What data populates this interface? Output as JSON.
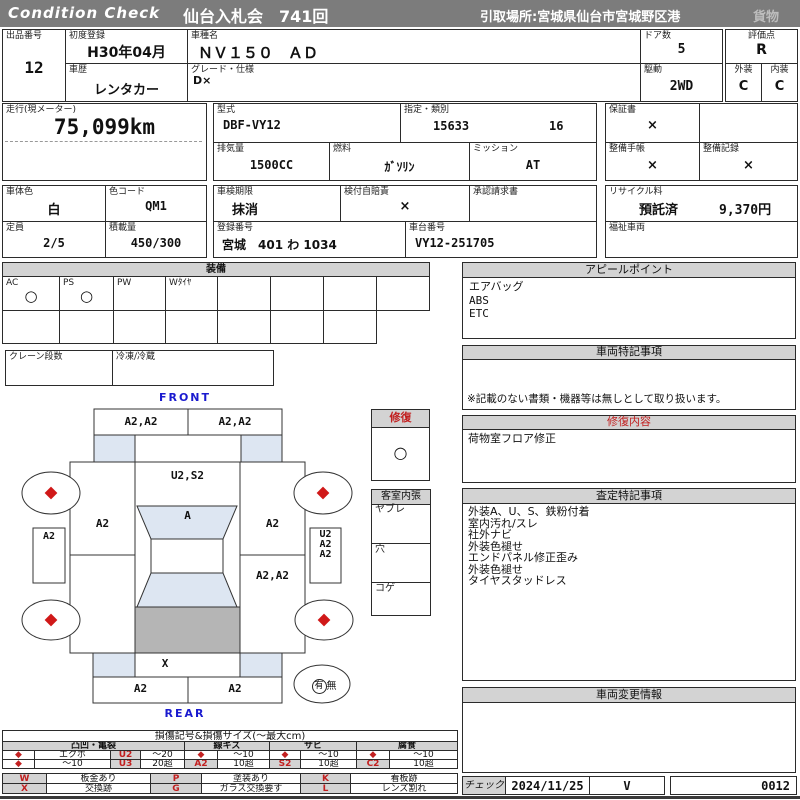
{
  "header": {
    "brand": "Condition  Check",
    "title": "仙台入札会　741回",
    "pickup": "引取場所:宮城県仙台市宮城野区港",
    "category": "貨物"
  },
  "row1": {
    "lot_label": "出品番号",
    "lot": "12",
    "first_reg_label": "初度登録",
    "first_reg": "H30年04月",
    "history_label": "車歴",
    "history": "レンタカー",
    "model_label": "車種名",
    "model": "ＮＶ１５０　ＡＤ",
    "grade_label": "グレード・仕様",
    "grade": "D×",
    "doors_label": "ドア数",
    "doors": "5",
    "drive_label": "駆動",
    "drive": "2WD",
    "score_label": "評価点",
    "score": "R",
    "exterior_label": "外装",
    "exterior": "C",
    "interior_label": "内装",
    "interior": "C"
  },
  "row2": {
    "mileage_label": "走行(現メーター)",
    "mileage": "75,099km",
    "model_code_label": "型式",
    "model_code": "DBF-VY12",
    "class_label": "指定・類別",
    "class1": "15633",
    "class2": "16",
    "displacement_label": "排気量",
    "displacement": "1500CC",
    "fuel_label": "燃料",
    "fuel": "ｶﾞｿﾘﾝ",
    "mission_label": "ミッション",
    "mission": "AT",
    "warranty_label": "保証書",
    "warranty": "×",
    "book_label": "整備手帳",
    "book": "×",
    "record_label": "整備記録",
    "record": "×"
  },
  "row3": {
    "body_color_label": "車体色",
    "body_color": "白",
    "color_code_label": "色コード",
    "color_code": "QM1",
    "capacity_label": "定員",
    "capacity": "2/5",
    "load_label": "積載量",
    "load": "450/300",
    "shaken_label": "車検期限",
    "shaken": "抹消",
    "jibaiseki_label": "検付自賠責",
    "jibaiseki": "×",
    "approval_label": "承認請求書",
    "reg_label": "登録番号",
    "reg_no": "宮城　401 わ 1034",
    "chassis_label": "車台番号",
    "chassis": "VY12-251705",
    "recycle_label": "リサイクル料",
    "recycle_status": "預託済",
    "recycle_fee": "9,370円",
    "welfare_label": "福祉車両"
  },
  "equipment": {
    "title": "装備",
    "c1_label": "AC",
    "c1_mark": "○",
    "c2_label": "PS",
    "c2_mark": "○",
    "c3_label": "PW",
    "c4_label": "Wﾀｲﾔ",
    "crane_label": "クレーン段数",
    "reefer_label": "冷凍/冷蔵"
  },
  "diagram": {
    "front": "FRONT",
    "rear": "REAR",
    "front_bumper_l": "A2,A2",
    "front_bumper_r": "A2,A2",
    "hood": "U2,S2",
    "windshield": "A",
    "fender_l": "A2",
    "fender_r": "A2",
    "mirror_l": "A2",
    "side_r1": "U2",
    "side_r2": "A2",
    "side_r3": "A2",
    "door_r": "A2,A2",
    "rear_panel": "X",
    "rear_bumper_l": "A2",
    "rear_bumper_r": "A2",
    "spare_yes": "有",
    "spare_no": "無"
  },
  "repair_box": {
    "title": "修復",
    "mark": "○"
  },
  "trim_box": {
    "title": "客室内張",
    "item1": "ヤブレ",
    "item2": "穴",
    "item3": "コゲ"
  },
  "panels": {
    "appeal_title": "アピールポイント",
    "appeal1": "エアバッグ",
    "appeal2": "ABS",
    "appeal3": "ETC",
    "special_title": "車両特記事項",
    "special_note": "※記載のない書類・機器等は無しとして取り扱います。",
    "repair_title": "修復内容",
    "repair_note": "荷物室フロア修正",
    "assess_title": "査定特記事項",
    "assess1": "外装A、U、S、鉄粉付着",
    "assess2": "室内汚れ/スレ",
    "assess3": "社外ナビ",
    "assess4": "外装色褪せ",
    "assess5": "エンドパネル修正歪み",
    "assess6": "外装色褪せ",
    "assess7": "タイヤスタッドレス",
    "change_title": "車両変更情報"
  },
  "legend": {
    "title": "損傷記号&損傷サイズ(～最大cm)",
    "g1": "凸凹・亀裂",
    "g2": "線キズ",
    "g3": "サビ",
    "g4": "腐食",
    "r1": [
      "◆",
      "エクボ",
      "U2",
      "～20",
      "◆",
      "～10",
      "◆",
      "～10",
      "◆",
      "～10"
    ],
    "r2": [
      "◆",
      "～10",
      "U3",
      "20超",
      "A2",
      "10超",
      "S2",
      "10超",
      "C2",
      "10超"
    ],
    "codes": [
      {
        "code": "W",
        "desc": "板金あり"
      },
      {
        "code": "P",
        "desc": "塗装あり"
      },
      {
        "code": "K",
        "desc": "看板跡"
      },
      {
        "code": "X",
        "desc": "交換跡"
      },
      {
        "code": "G",
        "desc": "ガラス交換要す"
      },
      {
        "code": "L",
        "desc": "レンズ割れ"
      }
    ]
  },
  "check": {
    "label": "チェック",
    "date": "2024/11/25",
    "inspector": "V",
    "serial": "0012"
  }
}
